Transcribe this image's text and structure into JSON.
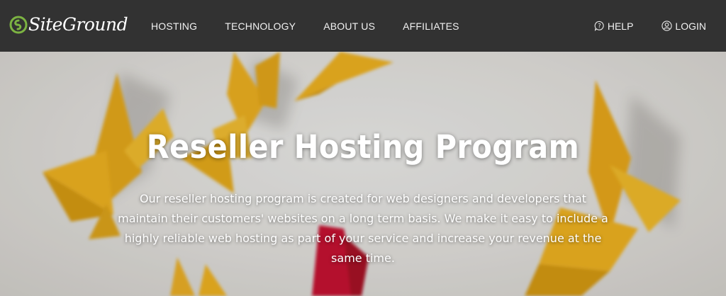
{
  "header": {
    "logo_text": "SiteGround",
    "nav": [
      "HOSTING",
      "TECHNOLOGY",
      "ABOUT US",
      "AFFILIATES"
    ],
    "help_label": "HELP",
    "login_label": "LOGIN"
  },
  "hero": {
    "title": "Reseller Hosting Program",
    "description": "Our reseller hosting program is created for web designers and developers that maintain their customers' websites on a long term basis. We make it easy to include a highly reliable web hosting as part of your service and increase your revenue at the same time."
  },
  "colors": {
    "header_bg": "#323232",
    "brand_green": "#7cb342",
    "origami_yellow": "#f2b31c",
    "origami_red": "#c8102e"
  }
}
